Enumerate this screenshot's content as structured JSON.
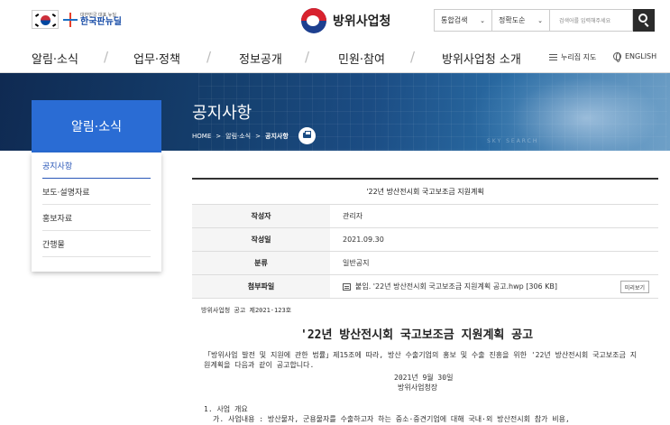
{
  "header": {
    "gov_brand_sub": "대한민국 대표 뉴딜",
    "gov_brand_main": "한국판뉴딜",
    "agency_name": "방위사업청",
    "search": {
      "scope_label": "통합검색",
      "sort_label": "정확도순",
      "placeholder": "검색어를 입력해주세요"
    }
  },
  "gnb": {
    "items": [
      "알림·소식",
      "업무·정책",
      "정보공개",
      "민원·참여",
      "방위사업청 소개"
    ],
    "sitemap_label": "누리집 지도",
    "english_label": "ENGLISH"
  },
  "hero": {
    "title": "공지사항",
    "breadcrumb": [
      "HOME",
      ">",
      "알림·소식",
      ">",
      "공지사항"
    ],
    "watermark": "SKY SEARCH"
  },
  "lnb": {
    "title": "알림·소식",
    "items": [
      "공지사항",
      "보도·설명자료",
      "홍보자료",
      "간행물"
    ]
  },
  "board": {
    "title": "'22년 방산전시회 국고보조금 지원계획",
    "rows": [
      {
        "label": "작성자",
        "value": "관리자"
      },
      {
        "label": "작성일",
        "value": "2021.09.30"
      },
      {
        "label": "분류",
        "value": "일반공지"
      },
      {
        "label": "첨부파일",
        "value": "붙임. '22년 방산전시회 국고보조금 지원계획 공고.hwp [306 KB]"
      }
    ],
    "preview_label": "미리보기"
  },
  "doc": {
    "number": "방위사업청 공고 제2021-123호",
    "title": "'22년 방산전시회 국고보조금 지원계획 공고",
    "paragraph": "「방위사업 발전 및 지원에 관한 법률」제15조에 따라, 방산 수출기업의 홍보 및 수출 진흥을 위한 '22년 방산전시회 국고보조금 지원계획을 다음과 같이 공고합니다.",
    "date": "2021년 9월 30일",
    "org": "방위사업청장",
    "section1": "1. 사업 개요",
    "section1a": "가. 사업내용 : 방산물자, 군용물자를 수출하고자 하는 중소·중견기업에 대해 국내·외 방산전시회 참가 비용,"
  }
}
